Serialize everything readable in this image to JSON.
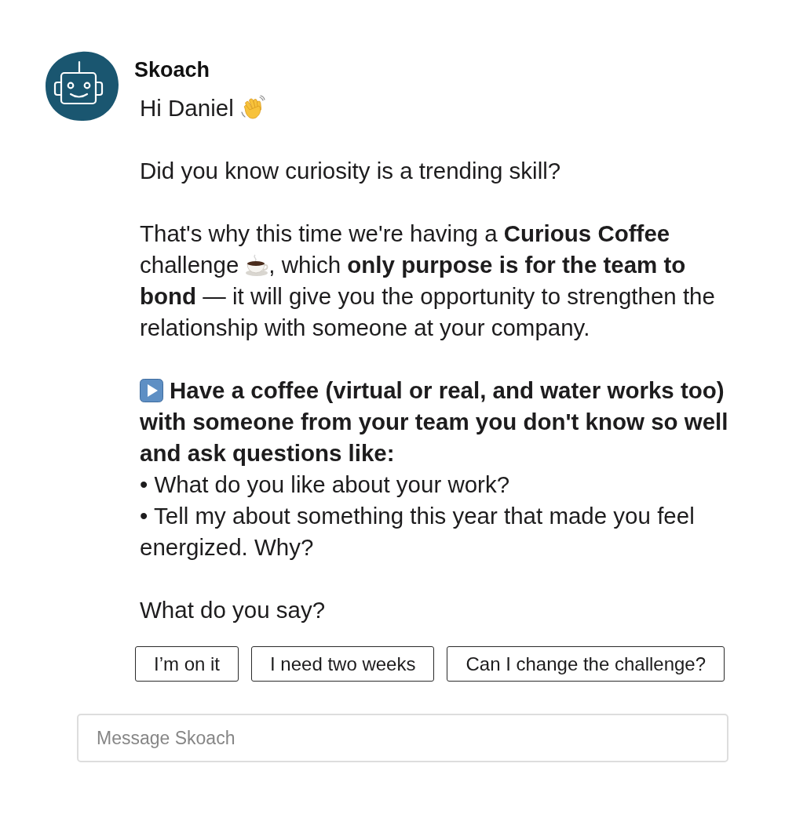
{
  "message": {
    "sender": "Skoach",
    "blocks": [
      {
        "segments": [
          {
            "kind": "text",
            "text": "Hi Daniel"
          },
          {
            "kind": "wave"
          }
        ]
      },
      {
        "segments": [
          {
            "kind": "text",
            "text": "Did you know curiosity is a trending skill?"
          }
        ]
      },
      {
        "segments": [
          {
            "kind": "text",
            "text": "That's why this time we're having a **Curious Coffee** challenge"
          },
          {
            "kind": "coffee"
          },
          {
            "kind": "text",
            "text": ", which **only purpose is for the team to bond** — it will give you the opportunity to strengthen the relationship with someone at your company."
          }
        ]
      },
      {
        "segments": [
          {
            "kind": "play"
          },
          {
            "kind": "strong",
            "text": "Have a coffee (virtual or real, and water works too) with someone from your team you don't know so well and ask questions like:"
          }
        ],
        "bullets": [
          "• What do you like about your work?",
          "• Tell my about something this year that made you feel energized. Why?"
        ]
      },
      {
        "segments": [
          {
            "kind": "text",
            "text": "What do you say?"
          }
        ]
      }
    ]
  },
  "actions": [
    "I’m on it",
    "I need two weeks",
    "Can I change the challenge?"
  ],
  "composer": {
    "placeholder": "Message Skoach"
  }
}
